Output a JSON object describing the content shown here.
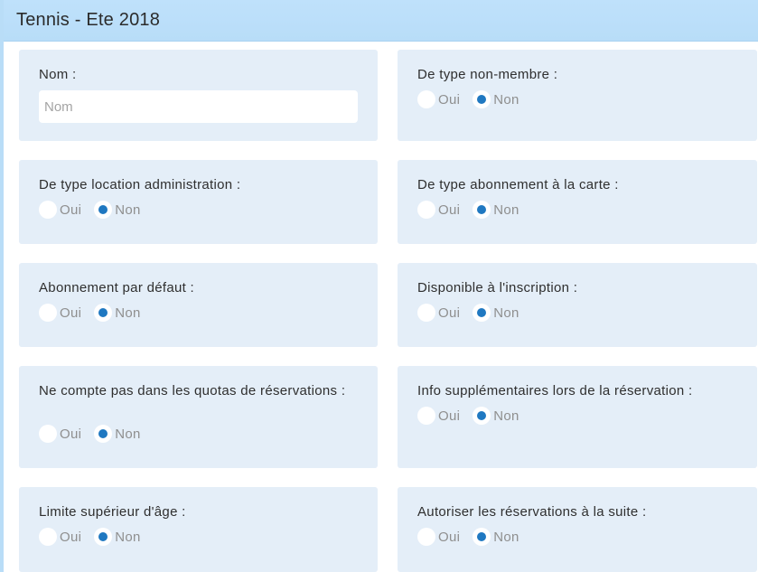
{
  "window": {
    "title": "Tennis - Ete 2018"
  },
  "colors": {
    "header": "#bfe1fb",
    "card": "#e4eef8",
    "radio_checked": "#1f78c1"
  },
  "form": {
    "nom": {
      "label": "Nom :",
      "value": "",
      "placeholder": "Nom"
    },
    "options": {
      "oui": "Oui",
      "non": "Non"
    },
    "fields": [
      {
        "label": "De type non-membre :",
        "selected": "Non"
      },
      {
        "label": "De type location administration :",
        "selected": "Non"
      },
      {
        "label": "De type abonnement à la carte :",
        "selected": "Non"
      },
      {
        "label": "Abonnement par défaut :",
        "selected": "Non"
      },
      {
        "label": "Disponible à l'inscription :",
        "selected": "Non"
      },
      {
        "label": "Ne compte pas dans les quotas de réservations :",
        "selected": "Non"
      },
      {
        "label": "Info supplémentaires lors de la réservation :",
        "selected": "Non"
      },
      {
        "label": "Limite supérieur d'âge :",
        "selected": "Non"
      },
      {
        "label": "Autoriser les réservations à la suite :",
        "selected": "Non"
      }
    ]
  }
}
